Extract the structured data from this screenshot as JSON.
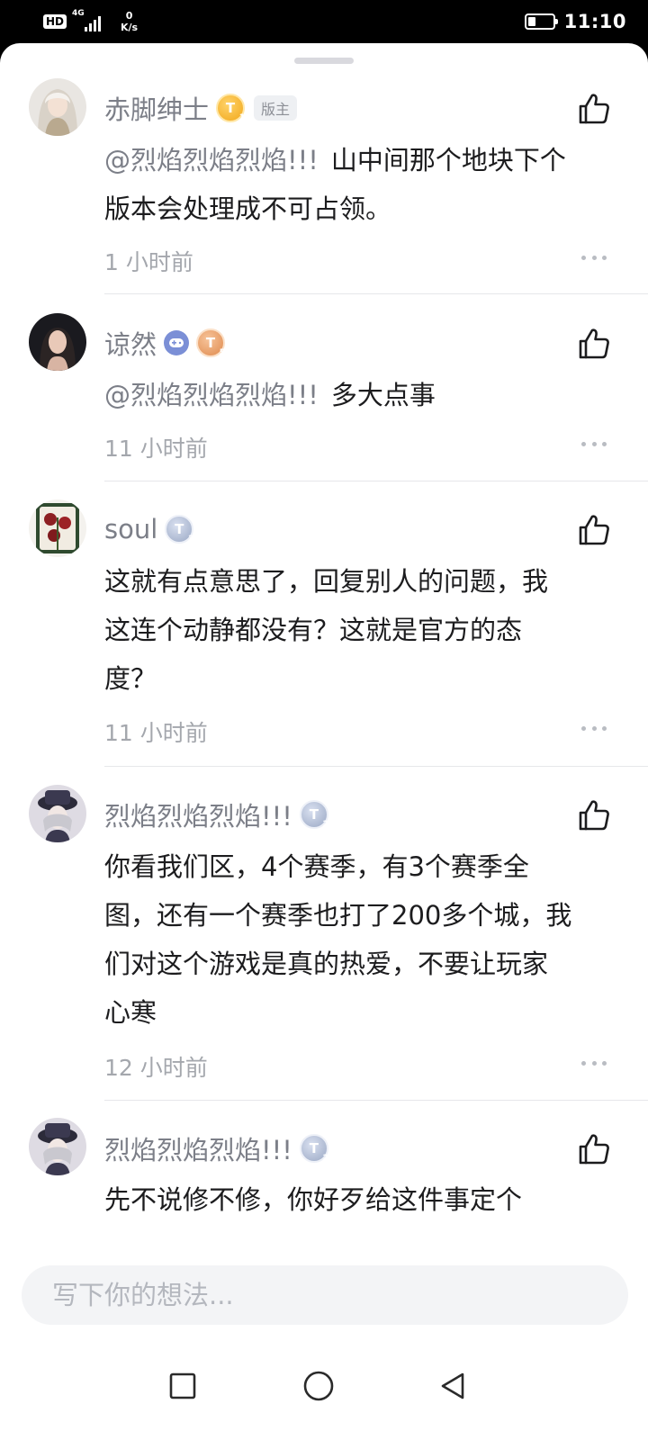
{
  "status_bar": {
    "hd": "HD",
    "network": "4G",
    "speed_value": "0",
    "speed_unit": "K/s",
    "time": "11:10",
    "battery_level": 0.3
  },
  "comments": [
    {
      "user": "赤脚绅士",
      "level_icon": "gold-level-badge",
      "role": "版主",
      "mention": "@烈焰烈焰烈焰!!!",
      "lines": [
        "山中间那个地块下个",
        "版本会处理成不可占领。"
      ],
      "time": "1 小时前"
    },
    {
      "user": "谅然",
      "level_icon": "bronze-level-badge",
      "mention": "@烈焰烈焰烈焰!!!",
      "lines": [
        "多大点事"
      ],
      "time": "11 小时前"
    },
    {
      "user": "soul",
      "level_icon": "silver-level-badge",
      "lines": [
        "这就有点意思了，回复别人的问题，我",
        "这连个动静都没有？这就是官方的态",
        "度？"
      ],
      "time": "11 小时前"
    },
    {
      "user": "烈焰烈焰烈焰!!!",
      "level_icon": "silver-level-badge",
      "lines": [
        "你看我们区，4个赛季，有3个赛季全",
        "图，还有一个赛季也打了200多个城，我",
        "们对这个游戏是真的热爱，不要让玩家",
        "心寒"
      ],
      "time": "12 小时前"
    },
    {
      "user": "烈焰烈焰烈焰!!!",
      "level_icon": "silver-level-badge",
      "lines": [
        "先不说修不修，你好歹给这件事定个"
      ]
    }
  ],
  "input": {
    "placeholder": "写下你的想法..."
  },
  "nav": {
    "recents_icon": "square-icon",
    "home_icon": "circle-icon",
    "back_icon": "triangle-back-icon"
  }
}
